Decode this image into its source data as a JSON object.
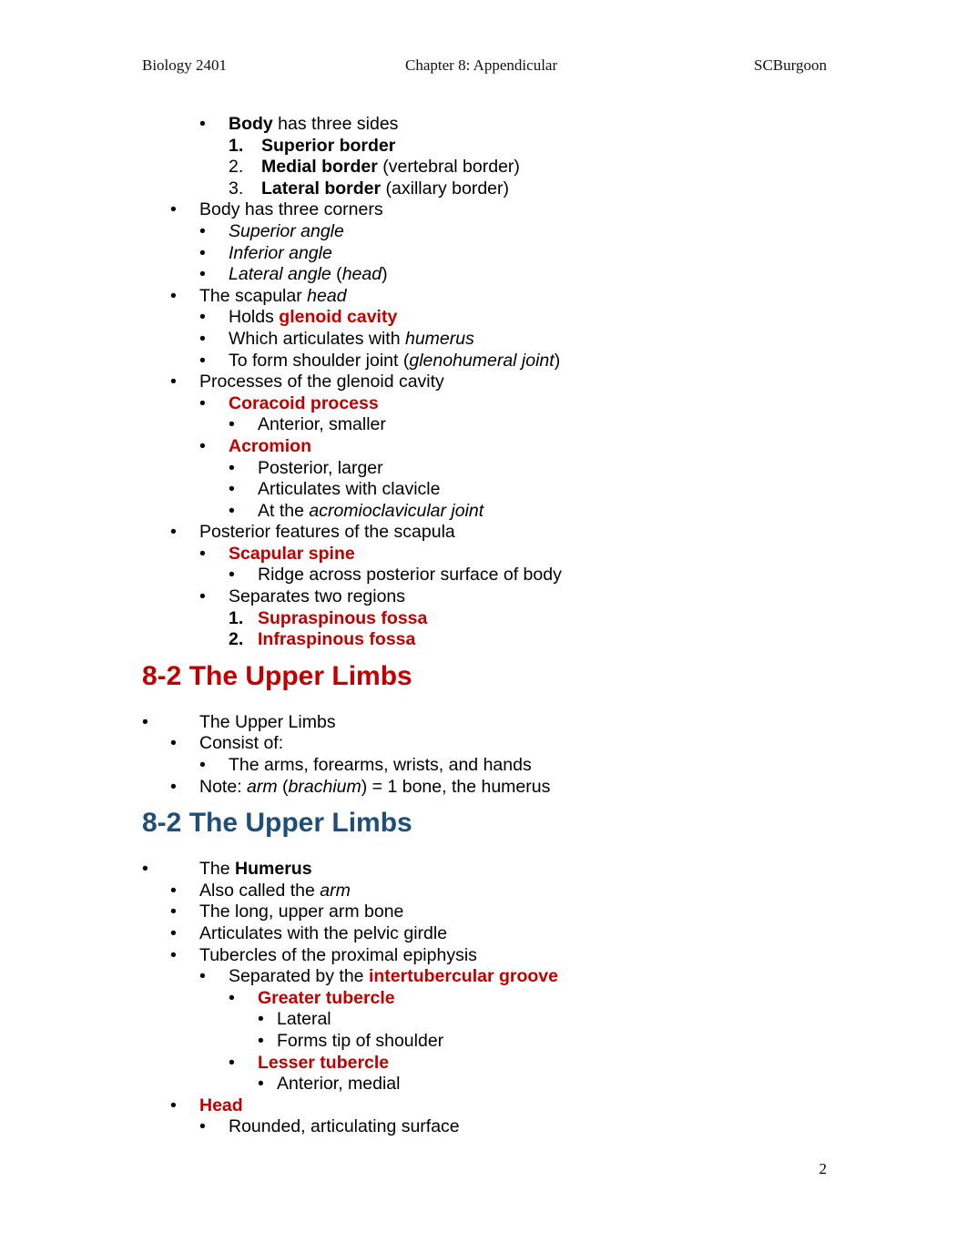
{
  "header": {
    "left": "Biology 2401",
    "center": "Chapter 8:  Appendicular",
    "right": "SCBurgoon"
  },
  "page_number": "2",
  "colors": {
    "term_red": "#c00000",
    "heading_red": "#c00000",
    "heading_blue": "#1f4e79"
  },
  "scapula": {
    "body_sides": {
      "lead": "Body",
      "rest": " has three sides"
    },
    "borders": [
      {
        "num": "1.",
        "term": "Superior border",
        "note": ""
      },
      {
        "num": "2.",
        "term": "Medial border",
        "note": " (vertebral border)"
      },
      {
        "num": "3.",
        "term": "Lateral border",
        "note": " (axillary border)"
      }
    ],
    "corners_title": "Body has three corners",
    "angles": [
      "Superior angle",
      "Inferior angle"
    ],
    "lateral_angle": {
      "a": "Lateral angle",
      "b": " (",
      "c": "head",
      "d": ")"
    },
    "head_title": {
      "a": "The scapular ",
      "b": "head"
    },
    "holds": {
      "a": "Holds ",
      "b": "glenoid cavity"
    },
    "articulates": {
      "a": "Which articulates with ",
      "b": "humerus"
    },
    "shoulder": {
      "a": "To form shoulder joint (",
      "b": "glenohumeral joint",
      "c": ")"
    },
    "processes_title": "Processes of the glenoid cavity",
    "coracoid": "Coracoid process",
    "coracoid_note": "Anterior, smaller",
    "acromion": "Acromion",
    "acromion_notes": [
      "Posterior, larger",
      "Articulates with clavicle"
    ],
    "ac_joint": {
      "a": "At the ",
      "b": "acromioclavicular joint"
    },
    "posterior_title": "Posterior features of the scapula",
    "spine": "Scapular spine",
    "spine_note": "Ridge across posterior surface of body",
    "separates": "Separates two regions",
    "fossae": [
      {
        "num": "1.",
        "term": "Supraspinous fossa"
      },
      {
        "num": "2.",
        "term": "Infraspinous fossa"
      }
    ]
  },
  "section1": {
    "heading": "8-2 The Upper Limbs",
    "title": "The Upper Limbs",
    "consist": "Consist of:",
    "parts": "The arms, forearms, wrists, and hands",
    "note": {
      "a": "Note: ",
      "b": "arm",
      "c": " (",
      "d": "brachium",
      "e": ") = 1 bone, the humerus"
    }
  },
  "section2": {
    "heading": "8-2 The Upper Limbs",
    "title": {
      "a": "The ",
      "b": "Humerus"
    },
    "also": {
      "a": "Also called the ",
      "b": "arm"
    },
    "long": "The long, upper arm bone",
    "articulates": "Articulates with the pelvic girdle",
    "tubercles": "Tubercles of the proximal epiphysis",
    "separated": {
      "a": "Separated by the ",
      "b": "intertubercular groove"
    },
    "greater": "Greater tubercle",
    "greater_notes": [
      "Lateral",
      "Forms tip of shoulder"
    ],
    "lesser": "Lesser tubercle",
    "lesser_note": "Anterior, medial",
    "head": "Head",
    "head_note": "Rounded, articulating surface"
  },
  "bullet": "•"
}
